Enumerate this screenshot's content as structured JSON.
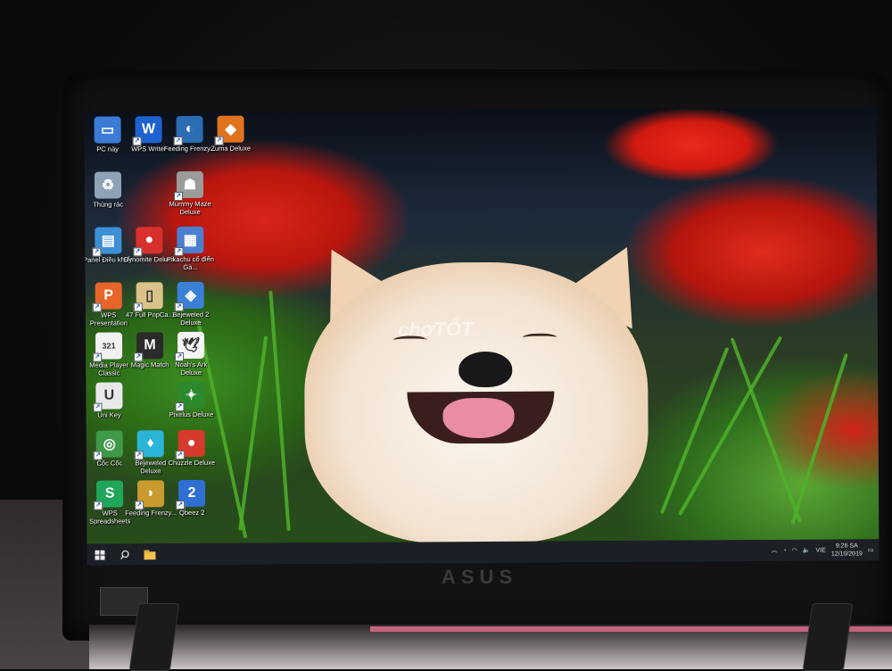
{
  "desktop": {
    "icons": [
      {
        "label": "PC này",
        "icon": "computer-icon",
        "color": "#3a7bd5",
        "glyph": "▭"
      },
      {
        "label": "WPS Writer",
        "icon": "wps-writer-icon",
        "color": "#1e62d0",
        "glyph": "W"
      },
      {
        "label": "Feeding Frenzy...",
        "icon": "feeding-frenzy-icon",
        "color": "#2b6db3",
        "glyph": "◐"
      },
      {
        "label": "Zuma Deluxe",
        "icon": "zuma-deluxe-icon",
        "color": "#e0731e",
        "glyph": "◆"
      },
      {
        "label": "Thùng rác",
        "icon": "recycle-bin-icon",
        "color": "#8fa3b8",
        "glyph": "♻"
      },
      {
        "label": "Mummy Maze Deluxe",
        "icon": "mummy-maze-icon",
        "color": "#9b9b9b",
        "glyph": "☗"
      },
      {
        "label": "Panel Điều khiển",
        "icon": "control-panel-icon",
        "color": "#3d8fd6",
        "glyph": "▤"
      },
      {
        "label": "Dynomite Deluxe",
        "icon": "dynomite-icon",
        "color": "#d8312d",
        "glyph": "●"
      },
      {
        "label": "Pikachu cổ điển Gà...",
        "icon": "pikachu-icon",
        "color": "#4a7fd0",
        "glyph": "▦"
      },
      {
        "label": "WPS Presentation",
        "icon": "wps-presentation-icon",
        "color": "#e8652a",
        "glyph": "P"
      },
      {
        "label": "47 Full PopCa...",
        "icon": "popcap-icon",
        "color": "#d9c38a",
        "glyph": "▯"
      },
      {
        "label": "Bejeweled 2 Deluxe",
        "icon": "bejeweled-2-icon",
        "color": "#3a7fd8",
        "glyph": "◈"
      },
      {
        "label": "Media Player Classic",
        "icon": "media-player-icon",
        "color": "#f2f2f2",
        "glyph": "321"
      },
      {
        "label": "Magic Match",
        "icon": "magic-match-icon",
        "color": "#2a2a2a",
        "glyph": "M"
      },
      {
        "label": "Noah's Ark Deluxe",
        "icon": "noahs-ark-icon",
        "color": "#f5f5f5",
        "glyph": "🕊"
      },
      {
        "label": "Uni Key",
        "icon": "unikey-icon",
        "color": "#e9e9e9",
        "glyph": "U"
      },
      {
        "label": "Pixelus Deluxe",
        "icon": "pixelus-icon",
        "color": "#2c8a2c",
        "glyph": "✦"
      },
      {
        "label": "Cốc Cốc",
        "icon": "coccoc-icon",
        "color": "#3f9a4a",
        "glyph": "◎"
      },
      {
        "label": "Bejeweled Deluxe",
        "icon": "bejeweled-icon",
        "color": "#2ab5d8",
        "glyph": "♦"
      },
      {
        "label": "Chuzzle Deluxe",
        "icon": "chuzzle-icon",
        "color": "#d53a2c",
        "glyph": "●"
      },
      {
        "label": "WPS Spreadsheets",
        "icon": "wps-spreadsheets-icon",
        "color": "#1fa65a",
        "glyph": "S"
      },
      {
        "label": "Feeding Frenzy...",
        "icon": "feeding-frenzy-2-icon",
        "color": "#c99a2e",
        "glyph": "◗"
      },
      {
        "label": "Qbeez 2",
        "icon": "qbeez-icon",
        "color": "#2f6fd3",
        "glyph": "2"
      }
    ]
  },
  "watermark": "chợTỐT",
  "taskbar": {
    "start_icon": "windows-start-icon",
    "search_icon": "search-icon",
    "explorer_icon": "file-explorer-icon",
    "tray": {
      "language": "VIE",
      "time": "9:26 SA",
      "date": "12/10/2019"
    }
  }
}
